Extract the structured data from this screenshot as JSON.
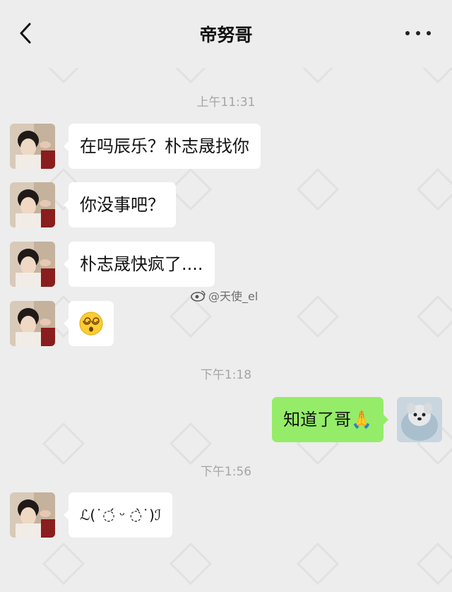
{
  "header": {
    "title": "帝努哥"
  },
  "messages": {
    "t1": "上午11:31",
    "m1": "在吗辰乐？朴志晟找你",
    "m2": "你没事吧？",
    "m3": "朴志晟快疯了....",
    "m4_emoji": "dizzy-face-emoji",
    "t2": "下午1:18",
    "m5": "知道了哥🙏",
    "t3": "下午1:56",
    "m6": "ℒ(˙◌́ ᵕ ◌̀˙)ℐ"
  },
  "overlay": {
    "weibo_watermark": "@天使_el"
  },
  "colors": {
    "background": "#ededed",
    "incoming_bubble": "#ffffff",
    "outgoing_bubble": "#95ec69",
    "timestamp": "#a5a5a5"
  }
}
